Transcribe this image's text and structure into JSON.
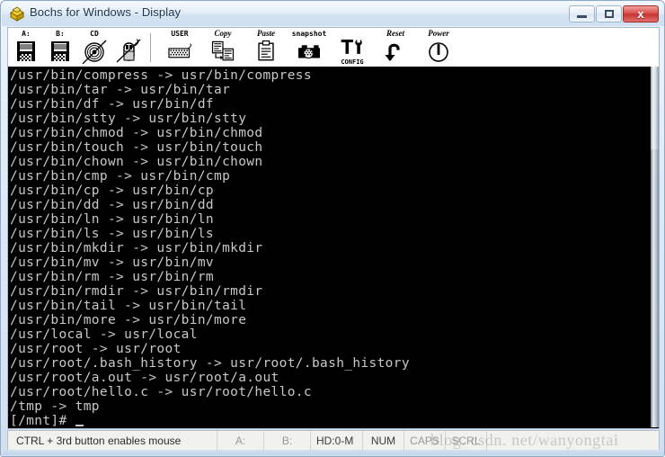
{
  "window": {
    "title": "Bochs for Windows - Display",
    "icon": "bochs-box-icon",
    "controls": {
      "minimize": "–",
      "maximize": "□",
      "close": "x"
    }
  },
  "toolbar": {
    "items": [
      {
        "label": "A:",
        "icon": "floppy-a-icon",
        "sublabel": ""
      },
      {
        "label": "B:",
        "icon": "floppy-b-icon",
        "sublabel": ""
      },
      {
        "label": "CD",
        "icon": "cdrom-icon",
        "sublabel": ""
      },
      {
        "label": "",
        "icon": "mouse-icon",
        "sublabel": ""
      },
      {
        "label": "USER",
        "icon": "keyboard-icon",
        "sublabel": ""
      },
      {
        "label": "Copy",
        "icon": "copy-icon",
        "sublabel": ""
      },
      {
        "label": "Paste",
        "icon": "paste-icon",
        "sublabel": ""
      },
      {
        "label": "snapshot",
        "icon": "camera-icon",
        "sublabel": ""
      },
      {
        "label": "",
        "icon": "config-tools-icon",
        "sublabel": "CONFIG"
      },
      {
        "label": "Reset",
        "icon": "reset-icon",
        "sublabel": ""
      },
      {
        "label": "Power",
        "icon": "power-icon",
        "sublabel": ""
      }
    ]
  },
  "terminal": {
    "lines": [
      "/usr/bin/compress -> usr/bin/compress",
      "/usr/bin/tar -> usr/bin/tar",
      "/usr/bin/df -> usr/bin/df",
      "/usr/bin/stty -> usr/bin/stty",
      "/usr/bin/chmod -> usr/bin/chmod",
      "/usr/bin/touch -> usr/bin/touch",
      "/usr/bin/chown -> usr/bin/chown",
      "/usr/bin/cmp -> usr/bin/cmp",
      "/usr/bin/cp -> usr/bin/cp",
      "/usr/bin/dd -> usr/bin/dd",
      "/usr/bin/ln -> usr/bin/ln",
      "/usr/bin/ls -> usr/bin/ls",
      "/usr/bin/mkdir -> usr/bin/mkdir",
      "/usr/bin/mv -> usr/bin/mv",
      "/usr/bin/rm -> usr/bin/rm",
      "/usr/bin/rmdir -> usr/bin/rmdir",
      "/usr/bin/tail -> usr/bin/tail",
      "/usr/bin/more -> usr/bin/more",
      "/usr/local -> usr/local",
      "/usr/root -> usr/root",
      "/usr/root/.bash_history -> usr/root/.bash_history",
      "/usr/root/a.out -> usr/root/a.out",
      "/usr/root/hello.c -> usr/root/hello.c",
      "/tmp -> tmp"
    ],
    "prompt": "[/mnt]# ",
    "cursor": "_",
    "foreground": "#c8c8c8",
    "background": "#000000"
  },
  "statusbar": {
    "message": "CTRL + 3rd button enables mouse",
    "floppy_a": "A:",
    "floppy_b": "B:",
    "hard_disk": "HD:0-M",
    "num_lock": "NUM",
    "caps_lock": "CAPS",
    "scroll_lock": "SCRL"
  },
  "watermark": {
    "text": "blog. csdn. net/wanyongtai"
  }
}
